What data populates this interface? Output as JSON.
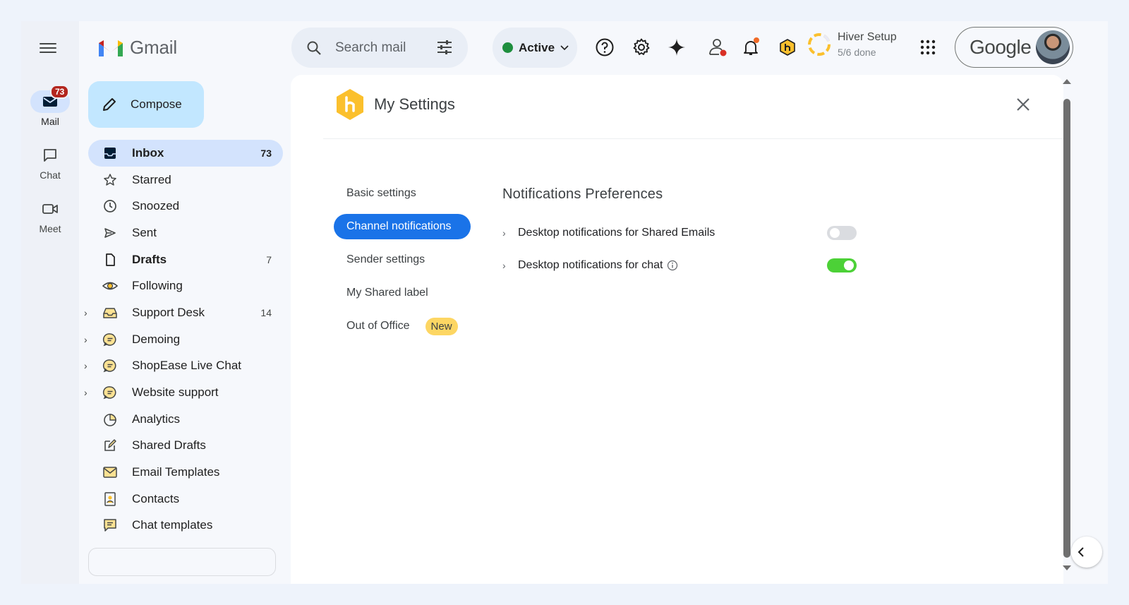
{
  "rail": {
    "items": [
      {
        "label": "Mail",
        "badge": "73"
      },
      {
        "label": "Chat"
      },
      {
        "label": "Meet"
      }
    ]
  },
  "app": {
    "name": "Gmail"
  },
  "compose": {
    "label": "Compose"
  },
  "nav": {
    "items": [
      {
        "label": "Inbox",
        "count": "73"
      },
      {
        "label": "Starred"
      },
      {
        "label": "Snoozed"
      },
      {
        "label": "Sent"
      },
      {
        "label": "Drafts",
        "count": "7"
      },
      {
        "label": "Following"
      },
      {
        "label": "Support Desk",
        "count": "14"
      },
      {
        "label": "Demoing"
      },
      {
        "label": "ShopEase Live Chat"
      },
      {
        "label": "Website support"
      },
      {
        "label": "Analytics"
      },
      {
        "label": "Shared Drafts"
      },
      {
        "label": "Email Templates"
      },
      {
        "label": "Contacts"
      },
      {
        "label": "Chat templates"
      }
    ]
  },
  "search": {
    "placeholder": "Search mail"
  },
  "status": {
    "label": "Active",
    "color": "#1e8e3e"
  },
  "hiver_setup": {
    "title": "Hiver Setup",
    "progress": "5/6 done"
  },
  "account": {
    "brand": "Google"
  },
  "settings": {
    "title": "My Settings",
    "nav": [
      {
        "label": "Basic settings"
      },
      {
        "label": "Channel notifications"
      },
      {
        "label": "Sender settings"
      },
      {
        "label": "My Shared label"
      },
      {
        "label": "Out of Office",
        "badge": "New"
      }
    ],
    "section_title": "Notifications Preferences",
    "preferences": [
      {
        "label": "Desktop notifications for Shared Emails",
        "enabled": false
      },
      {
        "label": "Desktop notifications for chat",
        "enabled": true
      }
    ]
  },
  "colors": {
    "accent": "#1a73e8",
    "toggle_on": "#4cd137",
    "hiver_yellow": "#fbc02d"
  }
}
